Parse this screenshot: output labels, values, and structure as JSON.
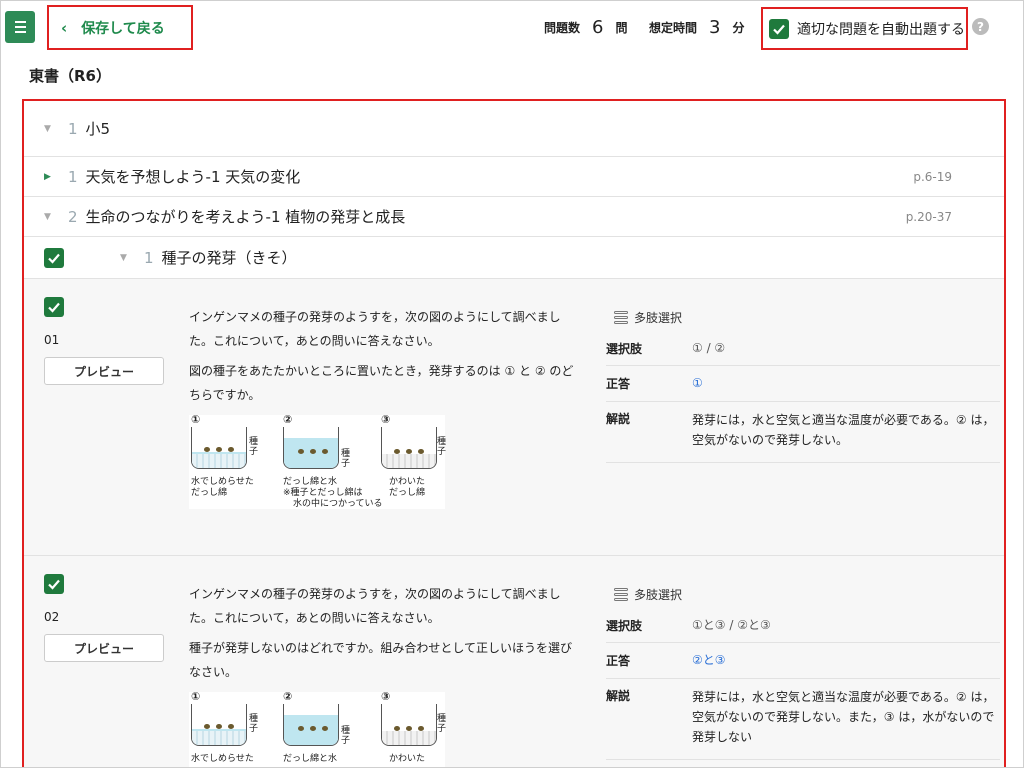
{
  "header": {
    "back_label": "保存して戻る",
    "count_label": "問題数",
    "count_value": "6",
    "count_unit": "問",
    "time_label": "想定時間",
    "time_value": "3",
    "time_unit": "分",
    "auto_label": "適切な問題を自動出題する",
    "help": "?"
  },
  "book_title": "東書（R6）",
  "tree": {
    "grade": {
      "num": "1",
      "label": "小5"
    },
    "units": [
      {
        "num": "1",
        "label": "天気を予想しよう-1 天気の変化",
        "pages": "p.6-19"
      },
      {
        "num": "2",
        "label": "生命のつながりを考えよう-1 植物の発芽と成長",
        "pages": "p.20-37"
      }
    ],
    "section": {
      "num": "1",
      "label": "種子の発芽（きそ）"
    }
  },
  "questions": [
    {
      "number": "01",
      "preview_label": "プレビュー",
      "text1": "インゲンマメの種子の発芽のようすを，次の図のようにして調べました。これについて，あとの問いに答えなさい。",
      "text2": "図の種子をあたたかいところに置いたとき，発芽するのは ① と ② のどちらですか。",
      "type_label": "多肢選択",
      "choices_key": "選択肢",
      "choices": "①  /  ②",
      "answer_key": "正答",
      "answer": "①",
      "explain_key": "解説",
      "explanation": "発芽には，水と空気と適当な温度が必要である。② は，空気がないので発芽しない。"
    },
    {
      "number": "02",
      "preview_label": "プレビュー",
      "text1": "インゲンマメの種子の発芽のようすを，次の図のようにして調べました。これについて，あとの問いに答えなさい。",
      "text2": "種子が発芽しないのはどれですか。組み合わせとして正しいほうを選びなさい。",
      "type_label": "多肢選択",
      "choices_key": "選択肢",
      "choices": "①と③  /  ②と③",
      "answer_key": "正答",
      "answer": "②と③",
      "explain_key": "解説",
      "explanation": "発芽には，水と空気と適当な温度が必要である。② は，空気がないので発芽しない。また，③ は，水がないので発芽しない"
    }
  ],
  "figure": {
    "n1": "①",
    "n2": "②",
    "n3": "③",
    "seed_label": "種子",
    "cap1a": "水でしめらせた",
    "cap1b": "だっし綿",
    "cap2a": "だっし綿と水",
    "cap2b": "※種子とだっし綿は",
    "cap2c": "水の中につかっている",
    "cap3a": "かわいた",
    "cap3b": "だっし綿"
  },
  "colors": {
    "accent": "#1f7a3d",
    "highlight_border": "#e02020",
    "answer": "#2a6fd6"
  }
}
